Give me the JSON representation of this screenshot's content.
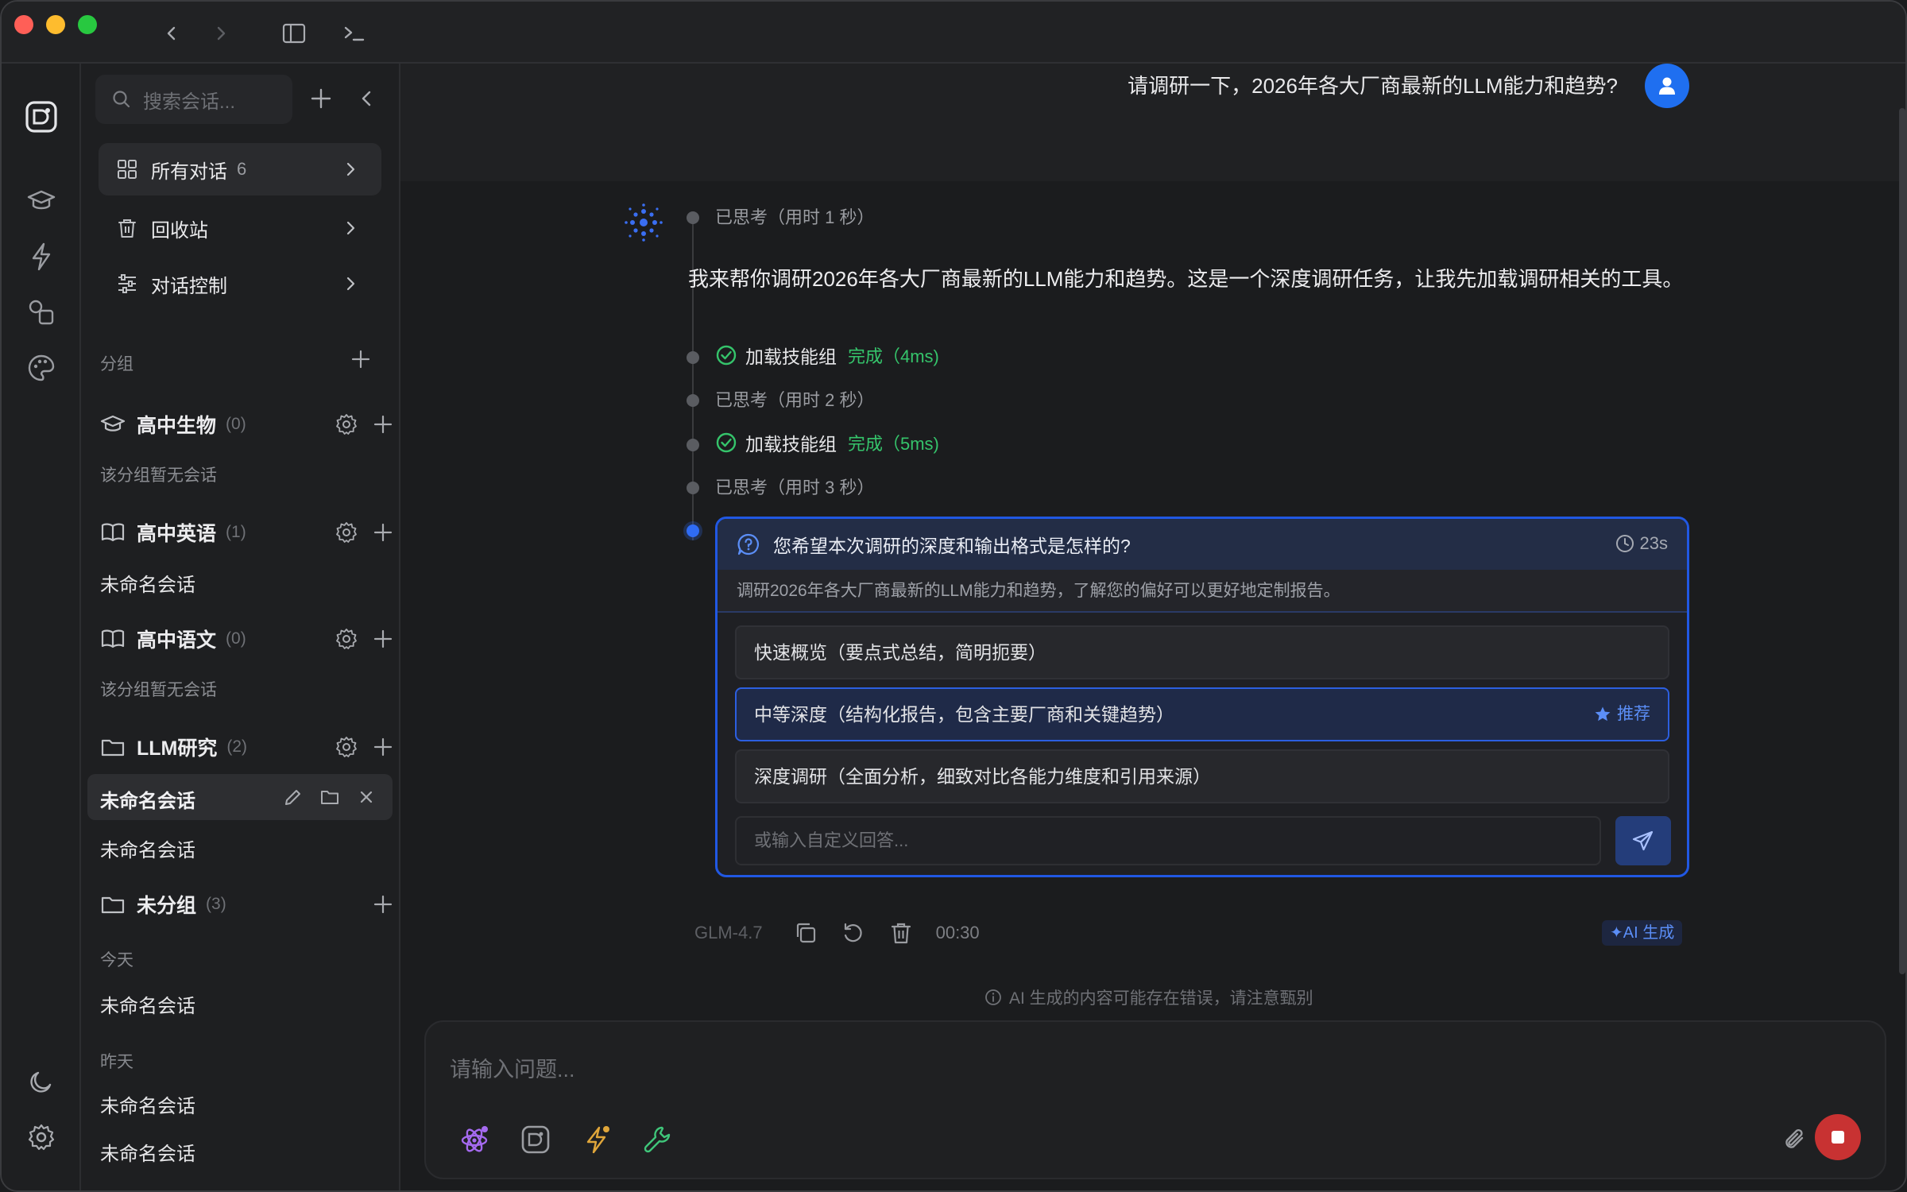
{
  "titlebar": {
    "back_label": "‹",
    "forward_label": "›"
  },
  "sidebar": {
    "search_placeholder": "搜索会话...",
    "nav": [
      {
        "label": "所有对话",
        "count": "6"
      },
      {
        "label": "回收站",
        "count": ""
      },
      {
        "label": "对话控制",
        "count": ""
      }
    ],
    "groups_label": "分组",
    "groups": [
      {
        "name": "高中生物",
        "count": "(0)",
        "items": [],
        "empty_text": "该分组暂无会话"
      },
      {
        "name": "高中英语",
        "count": "(1)",
        "items": [
          "未命名会话"
        ]
      },
      {
        "name": "高中语文",
        "count": "(0)",
        "items": [],
        "empty_text": "该分组暂无会话"
      },
      {
        "name": "LLM研究",
        "count": "(2)",
        "items": [
          "未命名会话",
          "未命名会话"
        ]
      },
      {
        "name": "未分组",
        "count": "(3)"
      }
    ],
    "today_label": "今天",
    "today_items": [
      "未命名会话"
    ],
    "yesterday_label": "昨天",
    "yesterday_items": [
      "未命名会话",
      "未命名会话"
    ]
  },
  "chat": {
    "user_message": "请调研一下，2026年各大厂商最新的LLM能力和趋势?",
    "thought_1": "已思考（用时 1 秒）",
    "answer": "我来帮你调研2026年各大厂商最新的LLM能力和趋势。这是一个深度调研任务，让我先加载调研相关的工具。",
    "tool_1": {
      "name": "加载技能组",
      "status": "完成（4ms)"
    },
    "thought_2": "已思考（用时 2 秒）",
    "tool_2": {
      "name": "加载技能组",
      "status": "完成（5ms)"
    },
    "thought_3": "已思考（用时 3 秒）",
    "question": {
      "title": "您希望本次调研的深度和输出格式是怎样的?",
      "timer": "23s",
      "description": "调研2026年各大厂商最新的LLM能力和趋势，了解您的偏好可以更好地定制报告。",
      "options": [
        {
          "label": "快速概览（要点式总结，简明扼要）"
        },
        {
          "label": "中等深度（结构化报告，包含主要厂商和关键趋势）",
          "tag": "推荐"
        },
        {
          "label": "深度调研（全面分析，细致对比各能力维度和引用来源）"
        }
      ],
      "custom_placeholder": "或输入自定义回答..."
    },
    "meta": {
      "model": "GLM-4.7",
      "elapsed": "00:30",
      "ai_badge": "✦AI 生成"
    },
    "disclaimer": "AI 生成的内容可能存在错误，请注意甄别"
  },
  "composer": {
    "placeholder": "请输入问题..."
  },
  "colors": {
    "accent": "#2158e3",
    "success": "#35c46b",
    "stop": "#c83232",
    "avatar": "#1f6ff0"
  }
}
